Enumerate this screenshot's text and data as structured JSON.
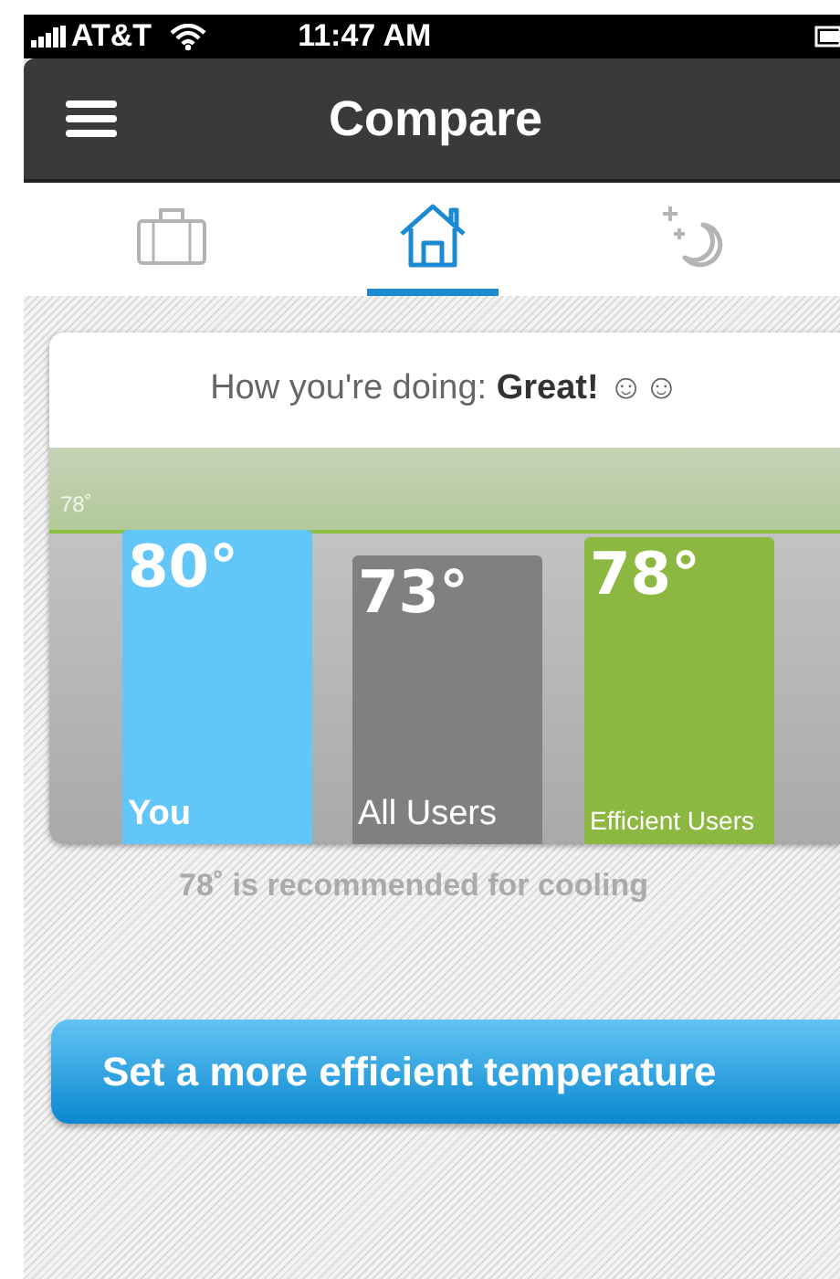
{
  "status_bar": {
    "carrier": "AT&T",
    "time": "11:47 AM"
  },
  "header": {
    "title": "Compare"
  },
  "tabs": [
    {
      "kind": "briefcase",
      "selected": false
    },
    {
      "kind": "house",
      "selected": true
    },
    {
      "kind": "night",
      "selected": false
    }
  ],
  "card": {
    "headline": "How you're doing: **Great!** ☺☺",
    "target_label": "78˚",
    "bars": [
      {
        "value": "80°",
        "label": "You",
        "color": "#63c6f9"
      },
      {
        "value": "73°",
        "label": "All Users",
        "color": "#808080"
      },
      {
        "value": "78°",
        "label": "Efficient Users",
        "color": "#8cb841"
      }
    ]
  },
  "caption": "78˚ is recommended for cooling",
  "action_button": "Set a more efficient temperature"
}
